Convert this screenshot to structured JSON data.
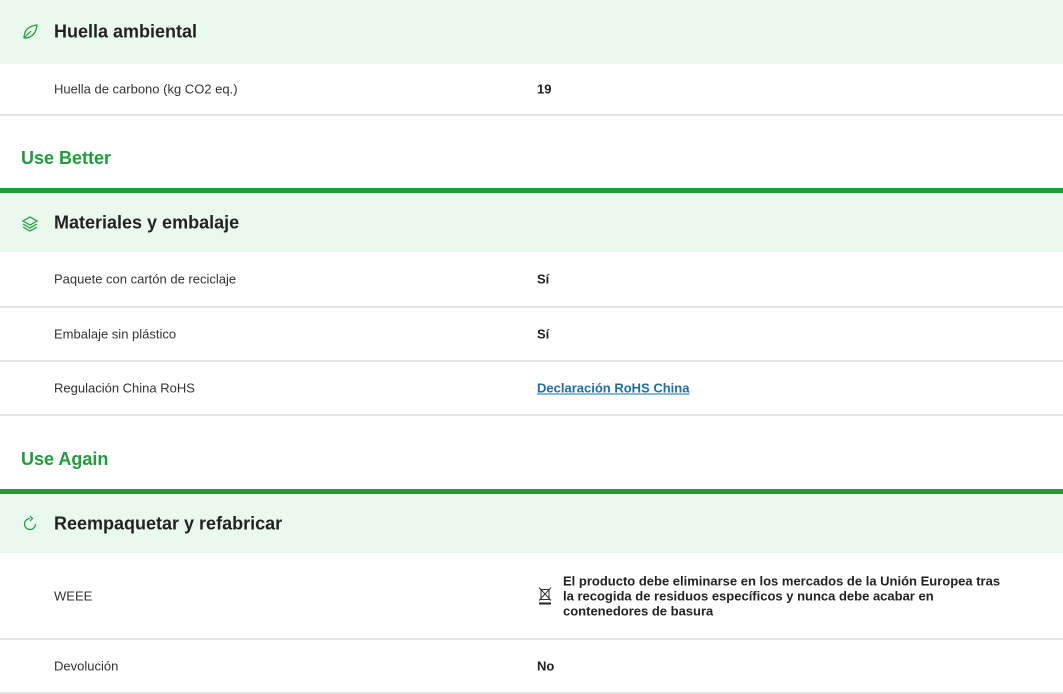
{
  "environmental": {
    "title": "Huella ambiental",
    "icon": "leaf-icon",
    "rows": [
      {
        "label": "Huella de carbono (kg CO2 eq.)",
        "value": "19"
      }
    ]
  },
  "use_better": {
    "group_title": "Use Better",
    "title": "Materiales y embalaje",
    "icon": "layers-icon",
    "rows": [
      {
        "label": "Paquete con cartón de reciclaje",
        "value": "Sí"
      },
      {
        "label": "Embalaje sin plástico",
        "value": "Sí"
      },
      {
        "label": "Regulación China RoHS",
        "value": "Declaración RoHS China"
      }
    ]
  },
  "use_again": {
    "group_title": "Use Again",
    "title": "Reempaquetar y refabricar",
    "icon": "refresh-icon",
    "rows": [
      {
        "label": "WEEE",
        "value": "El producto debe eliminarse en los mercados de la Unión Europea tras la recogida de residuos específicos y nunca debe acabar en contenedores de basura",
        "icon": "crossed-bin-icon"
      },
      {
        "label": "Devolución",
        "value": "No"
      }
    ]
  },
  "colors": {
    "accent": "#1f9d3a",
    "header_bg": "#eaf9ee",
    "link": "#1a6fa8"
  }
}
